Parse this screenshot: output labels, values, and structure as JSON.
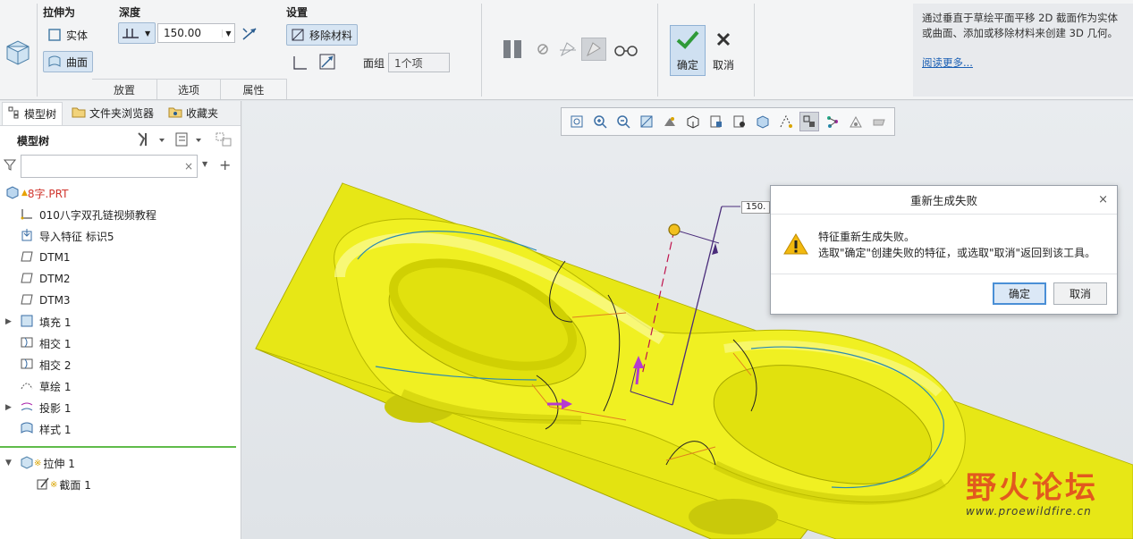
{
  "ribbon": {
    "extrude_as": {
      "label": "拉伸为",
      "solid": "实体",
      "surface": "曲面"
    },
    "depth": {
      "label": "深度",
      "value": "150.00"
    },
    "settings": {
      "label": "设置",
      "remove_material": "移除材料",
      "face_group_label": "面组",
      "face_group_value": "1个项"
    },
    "tabs": [
      "放置",
      "选项",
      "属性"
    ],
    "ok": "确定",
    "cancel": "取消",
    "help": {
      "text": "通过垂直于草绘平面平移 2D 截面作为实体或曲面、添加或移除材料来创建 3D 几何。",
      "link": "阅读更多..."
    }
  },
  "left_panel": {
    "tabs": [
      "模型树",
      "文件夹浏览器",
      "收藏夹"
    ],
    "tree_title": "模型树",
    "search_placeholder": "",
    "tree": [
      {
        "label": "8字.PRT",
        "icon": "part-icon",
        "expand": false,
        "color": "#d0342c"
      },
      {
        "label": "010八字双孔链视频教程",
        "icon": "csys-icon",
        "expand": false
      },
      {
        "label": "导入特征 标识5",
        "icon": "import-icon",
        "expand": false
      },
      {
        "label": "DTM1",
        "icon": "datum-plane-icon",
        "expand": false
      },
      {
        "label": "DTM2",
        "icon": "datum-plane-icon",
        "expand": false
      },
      {
        "label": "DTM3",
        "icon": "datum-plane-icon",
        "expand": false
      },
      {
        "label": "填充 1",
        "icon": "fill-icon",
        "expand": true
      },
      {
        "label": "相交 1",
        "icon": "intersect-icon",
        "expand": false
      },
      {
        "label": "相交 2",
        "icon": "intersect-icon",
        "expand": false
      },
      {
        "label": "草绘 1",
        "icon": "sketch-icon",
        "expand": false
      },
      {
        "label": "投影 1",
        "icon": "projection-icon",
        "expand": true
      },
      {
        "label": "样式 1",
        "icon": "style-icon",
        "expand": false
      }
    ],
    "active_feature": "拉伸 1",
    "active_sub": "截面 1"
  },
  "viewport": {
    "dimension_label": "150."
  },
  "dialog": {
    "title": "重新生成失败",
    "line1": "特征重新生成失败。",
    "line2": "选取\"确定\"创建失败的特征，或选取\"取消\"返回到该工具。",
    "ok": "确定",
    "cancel": "取消"
  },
  "watermark": {
    "brand": "野火论坛",
    "url": "www.proewildfire.cn"
  },
  "colors": {
    "part": "#e8e81a",
    "accent": "#4a8fd6"
  }
}
